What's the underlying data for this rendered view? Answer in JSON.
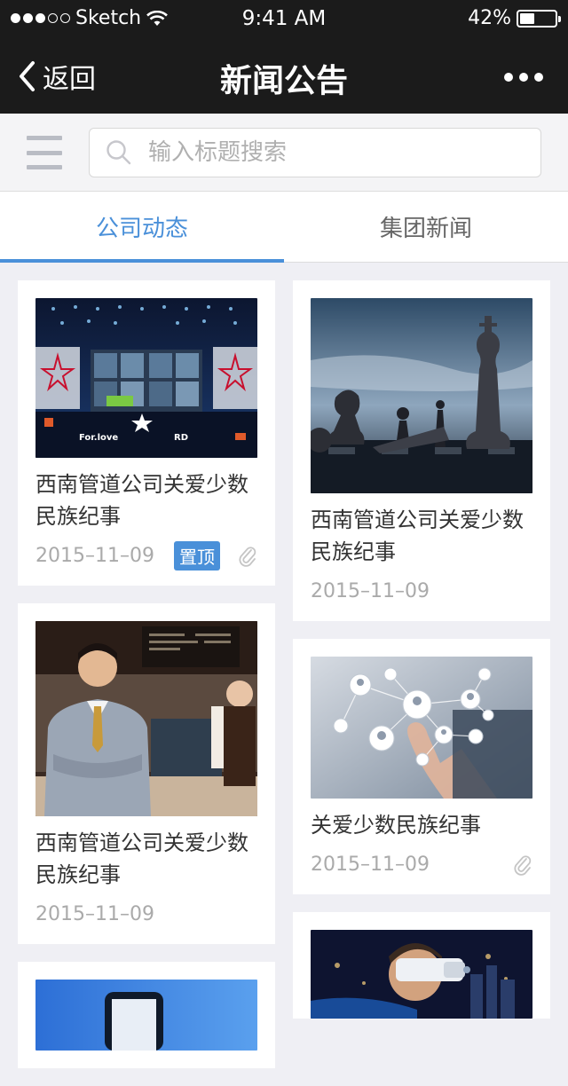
{
  "status_bar": {
    "carrier": "Sketch",
    "time": "9:41 AM",
    "battery": "42%",
    "battery_level": 0.42
  },
  "nav": {
    "back_label": "返回",
    "title": "新闻公告"
  },
  "search": {
    "placeholder": "输入标题搜索"
  },
  "tabs": [
    {
      "label": "公司动态",
      "active": true
    },
    {
      "label": "集团新闻",
      "active": false
    }
  ],
  "articles": {
    "left": [
      {
        "title": "西南管道公司关爱少数民族纪事",
        "date": "2015–11–09",
        "badge": "置顶",
        "attachment": true,
        "image": "stage-event",
        "image_text": "For.love"
      },
      {
        "title": "西南管道公司关爱少数民族纪事",
        "date": "2015–11–09",
        "image": "barista-portrait"
      },
      {
        "image": "phone-photo"
      }
    ],
    "right": [
      {
        "title": "西南管道公司关爱少数民族纪事",
        "date": "2015–11–09",
        "image": "chess-pieces"
      },
      {
        "title": "关爱少数民族纪事",
        "date": "2015–11–09",
        "attachment": true,
        "image": "network-touch"
      },
      {
        "image": "vr-headset"
      }
    ]
  }
}
